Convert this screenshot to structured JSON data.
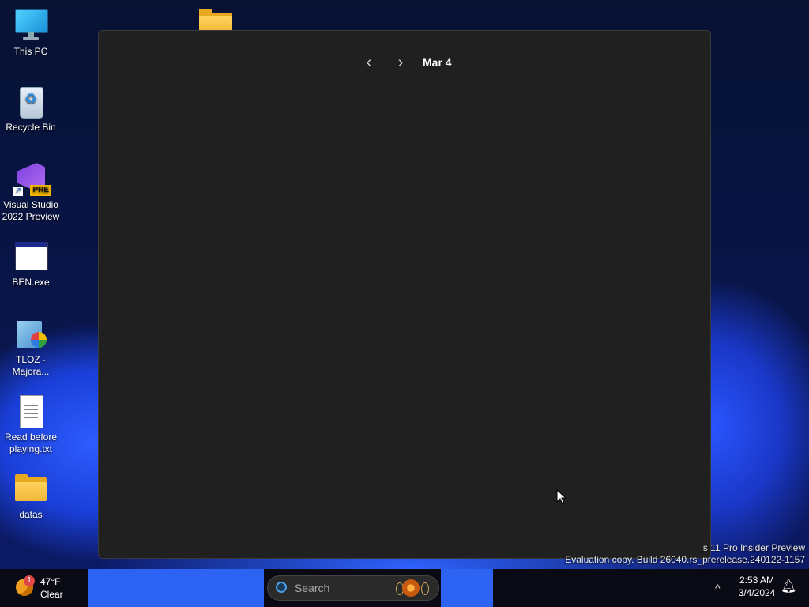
{
  "desktop": {
    "icons": [
      {
        "label": "This PC",
        "icon": "this-pc-icon"
      },
      {
        "label": "Recycle Bin",
        "icon": "recycle-bin-icon"
      },
      {
        "label": "Visual Studio 2022 Preview",
        "icon": "visual-studio-icon",
        "badge": "PRE"
      },
      {
        "label": "BEN.exe",
        "icon": "app-window-icon"
      },
      {
        "label": "TLOZ - Majora...",
        "icon": "setup-package-icon"
      },
      {
        "label": "Read before playing.txt",
        "icon": "text-file-icon"
      },
      {
        "label": "datas",
        "icon": "folder-icon"
      }
    ]
  },
  "calendar": {
    "prev_label": "‹",
    "next_label": "›",
    "date": "Mar 4"
  },
  "watermark": {
    "line1": "s 11 Pro Insider Preview",
    "line2": "Evaluation copy. Build 26040.rs_prerelease.240122-1157"
  },
  "taskbar": {
    "weather": {
      "badge": "1",
      "temp": "47°F",
      "condition": "Clear"
    },
    "search": {
      "placeholder": "Search"
    },
    "tray_chevron": "^",
    "clock": {
      "time": "2:53 AM",
      "date": "3/4/2024"
    },
    "notification_icon": "notification-bell-icon"
  },
  "colors": {
    "panel_bg": "#202020",
    "taskbar_bg": "#0a0a14",
    "accent_blue": "#2d63f3"
  }
}
